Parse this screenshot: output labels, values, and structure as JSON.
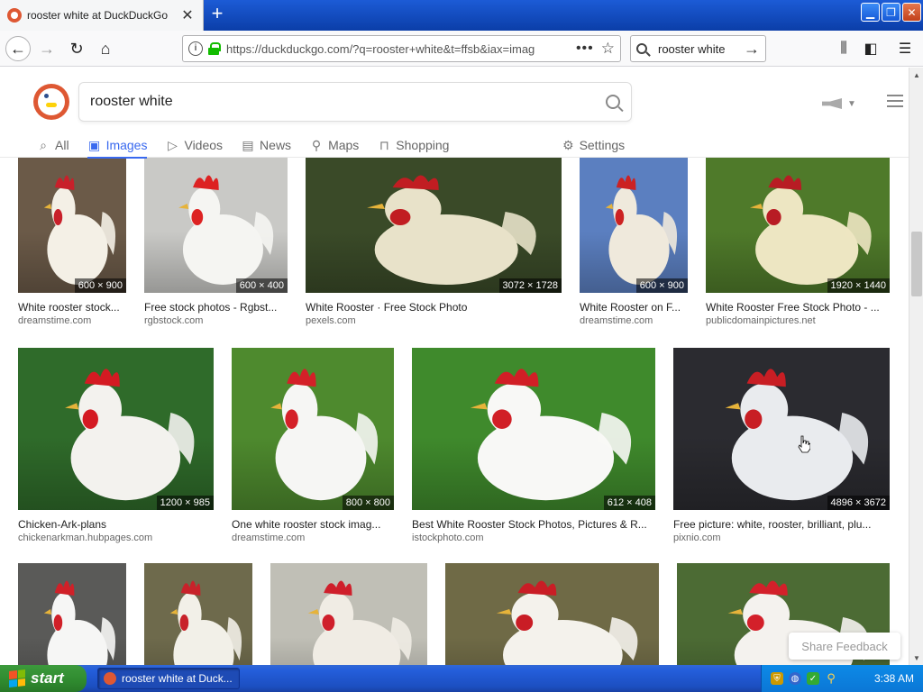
{
  "browser": {
    "tab_title": "rooster white at DuckDuckGo",
    "new_tab_label": "+",
    "url": "https://duckduckgo.com/?q=rooster+white&t=ffsb&iax=imag",
    "url_more": "•••",
    "searchbar_text": "rooster white"
  },
  "ddg": {
    "search_value": "rooster white",
    "tabs": [
      {
        "label": "All",
        "icon": "search-icon"
      },
      {
        "label": "Images",
        "icon": "image-icon",
        "active": true
      },
      {
        "label": "Videos",
        "icon": "play-icon"
      },
      {
        "label": "News",
        "icon": "newspaper-icon"
      },
      {
        "label": "Maps",
        "icon": "map-pin-icon"
      },
      {
        "label": "Shopping",
        "icon": "shopping-bag-icon"
      }
    ],
    "settings_label": "Settings",
    "share_feedback": "Share Feedback"
  },
  "results": [
    {
      "title": "White rooster stock...",
      "source": "dreamstime.com",
      "dims": "600 × 900",
      "bg": "#6b5a48",
      "bird": "#f4f0e6",
      "comb": "#c8202a"
    },
    {
      "title": "Free stock photos - Rgbst...",
      "source": "rgbstock.com",
      "dims": "600 × 400",
      "bg": "#c9c9c6",
      "bird": "#f5f5f2",
      "comb": "#d22"
    },
    {
      "title": "White Rooster · Free Stock Photo",
      "source": "pexels.com",
      "dims": "3072 × 1728",
      "bg": "#3a4a28",
      "bird": "#e8e2c9",
      "comb": "#c11d22"
    },
    {
      "title": "White Rooster on F...",
      "source": "dreamstime.com",
      "dims": "600 × 900",
      "bg": "#5b7fc0",
      "bird": "#efe9dc",
      "comb": "#c22"
    },
    {
      "title": "White Rooster Free Stock Photo - ...",
      "source": "publicdomainpictures.net",
      "dims": "1920 × 1440",
      "bg": "#4f7a2a",
      "bird": "#ede6c2",
      "comb": "#b81c24"
    },
    {
      "title": "Chicken-Ark-plans",
      "source": "chickenarkman.hubpages.com",
      "dims": "1200 × 985",
      "bg": "#2f6b2a",
      "bird": "#f3f2ee",
      "comb": "#d41a22"
    },
    {
      "title": "One white rooster stock imag...",
      "source": "dreamstime.com",
      "dims": "800 × 800",
      "bg": "#4e8a2e",
      "bird": "#f6f6f4",
      "comb": "#d42028"
    },
    {
      "title": "Best White Rooster Stock Photos, Pictures & R...",
      "source": "istockphoto.com",
      "dims": "612 × 408",
      "bg": "#3f8a2c",
      "bird": "#f8f8f6",
      "comb": "#d11f26"
    },
    {
      "title": "Free picture: white, rooster, brilliant, plu...",
      "source": "pixnio.com",
      "dims": "4896 × 3672",
      "bg": "#2b2b30",
      "bird": "#e9ebee",
      "comb": "#c81e24"
    },
    {
      "title": "",
      "source": "",
      "dims": "",
      "bg": "#5a5a58",
      "bird": "#f6f6f5",
      "comb": "#d02028"
    },
    {
      "title": "",
      "source": "",
      "dims": "",
      "bg": "#6e6a4c",
      "bird": "#f2f0e8",
      "comb": "#c8222a"
    },
    {
      "title": "",
      "source": "",
      "dims": "",
      "bg": "#c0bfb6",
      "bird": "#f0ece4",
      "comb": "#cf1f2b"
    },
    {
      "title": "",
      "source": "",
      "dims": "",
      "bg": "#6f6a46",
      "bird": "#f4f2ec",
      "comb": "#c91d25"
    },
    {
      "title": "",
      "source": "",
      "dims": "",
      "bg": "#4c6b34",
      "bird": "#f4f2ee",
      "comb": "#d3202a"
    }
  ],
  "taskbar": {
    "start_label": "start",
    "task_label": "rooster white at Duck...",
    "clock": "3:38 AM"
  }
}
